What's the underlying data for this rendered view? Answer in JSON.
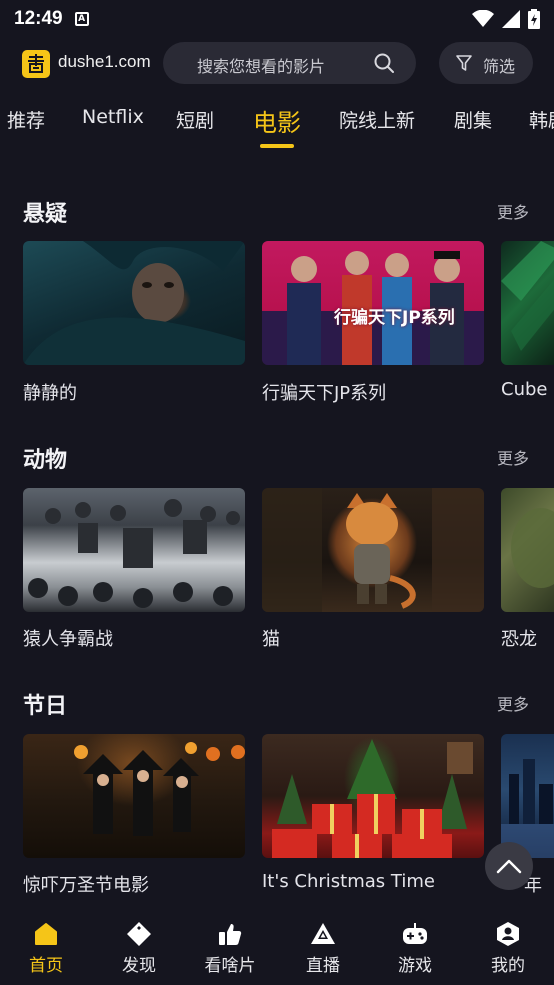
{
  "status": {
    "time": "12:49"
  },
  "header": {
    "site_name": "dushe1.com",
    "search_placeholder": "搜索您想看的影片",
    "filter_label": "筛选"
  },
  "tabs": [
    {
      "label": "推荐"
    },
    {
      "label": "Netflix"
    },
    {
      "label": "短剧"
    },
    {
      "label": "电影"
    },
    {
      "label": "院线上新"
    },
    {
      "label": "剧集"
    },
    {
      "label": "韩剧"
    }
  ],
  "active_tab": "电影",
  "sections": [
    {
      "title": "悬疑",
      "more": "更多",
      "items": [
        {
          "title": "静静的"
        },
        {
          "title": "行骗天下JP系列",
          "poster_text": "行骗天下JP系列"
        },
        {
          "title": "Cube"
        }
      ]
    },
    {
      "title": "动物",
      "more": "更多",
      "items": [
        {
          "title": "猿人争霸战"
        },
        {
          "title": "猫"
        },
        {
          "title": "恐龙"
        }
      ]
    },
    {
      "title": "节日",
      "more": "更多",
      "items": [
        {
          "title": "惊吓万圣节电影"
        },
        {
          "title": "It's Christmas Time"
        },
        {
          "title": "年"
        }
      ]
    }
  ],
  "bottom_nav": [
    {
      "label": "首页",
      "icon": "home-icon",
      "active": true
    },
    {
      "label": "发现",
      "icon": "discover-icon"
    },
    {
      "label": "看啥片",
      "icon": "thumbs-up-icon"
    },
    {
      "label": "直播",
      "icon": "live-icon"
    },
    {
      "label": "游戏",
      "icon": "gamepad-icon"
    },
    {
      "label": "我的",
      "icon": "profile-icon"
    }
  ],
  "colors": {
    "accent": "#f5c518",
    "background": "#15151f",
    "surface": "#2a2a35"
  }
}
